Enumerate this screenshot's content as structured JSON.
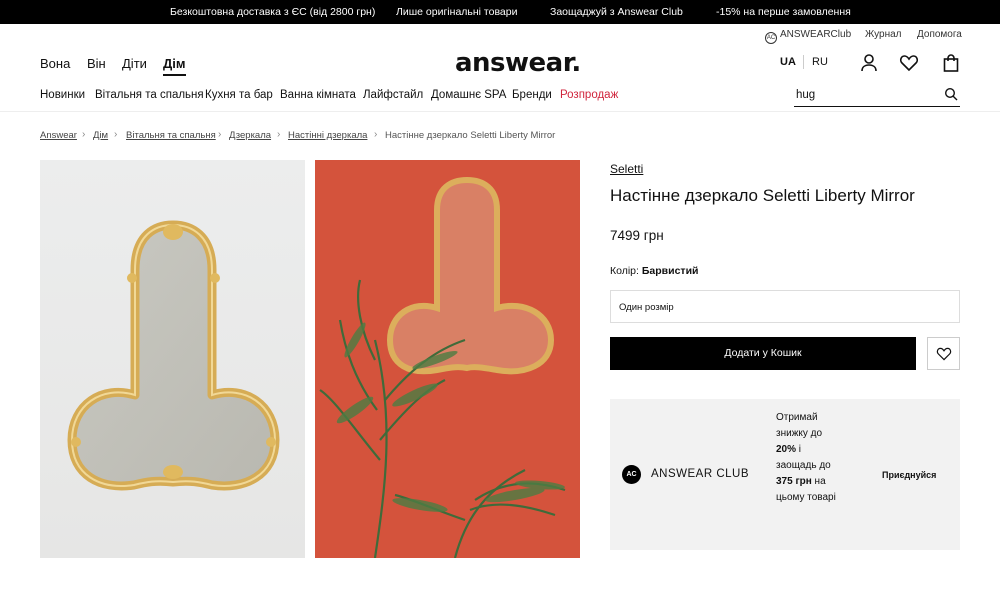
{
  "promo": [
    "Безкоштовна доставка з ЄС (від 2800 грн)",
    "Лише оригінальні товари",
    "Заощаджуй з Answear Club",
    "-15% на перше замовлення"
  ],
  "utility": {
    "club": "ANSWEARClub",
    "club_badge": "AC",
    "journal": "Журнал",
    "help": "Допомога"
  },
  "gender_nav": [
    "Вона",
    "Він",
    "Діти",
    "Дім"
  ],
  "logo": "answear.",
  "lang": {
    "active": "UA",
    "other": "RU"
  },
  "categories": [
    "Новинки",
    "Вітальня та спальня",
    "Кухня та бар",
    "Ванна кімната",
    "Лайфстайл",
    "Домашнє SPA",
    "Бренди",
    "Розпродаж"
  ],
  "search": {
    "value": "hug"
  },
  "breadcrumb": [
    "Answear",
    "Дім",
    "Вітальня та спальня",
    "Дзеркала",
    "Настінні дзеркала",
    "Настінне дзеркало Seletti Liberty Mirror"
  ],
  "product": {
    "brand": "Seletti",
    "title": "Настінне дзеркало Seletti Liberty Mirror",
    "price": "7499 грн",
    "color_label": "Колір:",
    "color_value": "Барвистий",
    "size": "Один розмір",
    "add_to_cart": "Додати у Кошик"
  },
  "club": {
    "badge": "AC",
    "name": "ANSWEAR CLUB",
    "text_1": "Отримай знижку до ",
    "pct": "20%",
    "text_2": " і заощадь до ",
    "amount": "375 грн",
    "text_3": " на цьому товарі",
    "join": "Приєднуйся"
  },
  "colors": {
    "sale": "#d0253c",
    "photo2_bg": "#d4533c",
    "gold": "#d9b25a"
  },
  "icons": [
    "user-icon",
    "heart-icon",
    "bag-icon",
    "search-icon",
    "wishlist-heart-icon",
    "chevron-right-icon"
  ]
}
